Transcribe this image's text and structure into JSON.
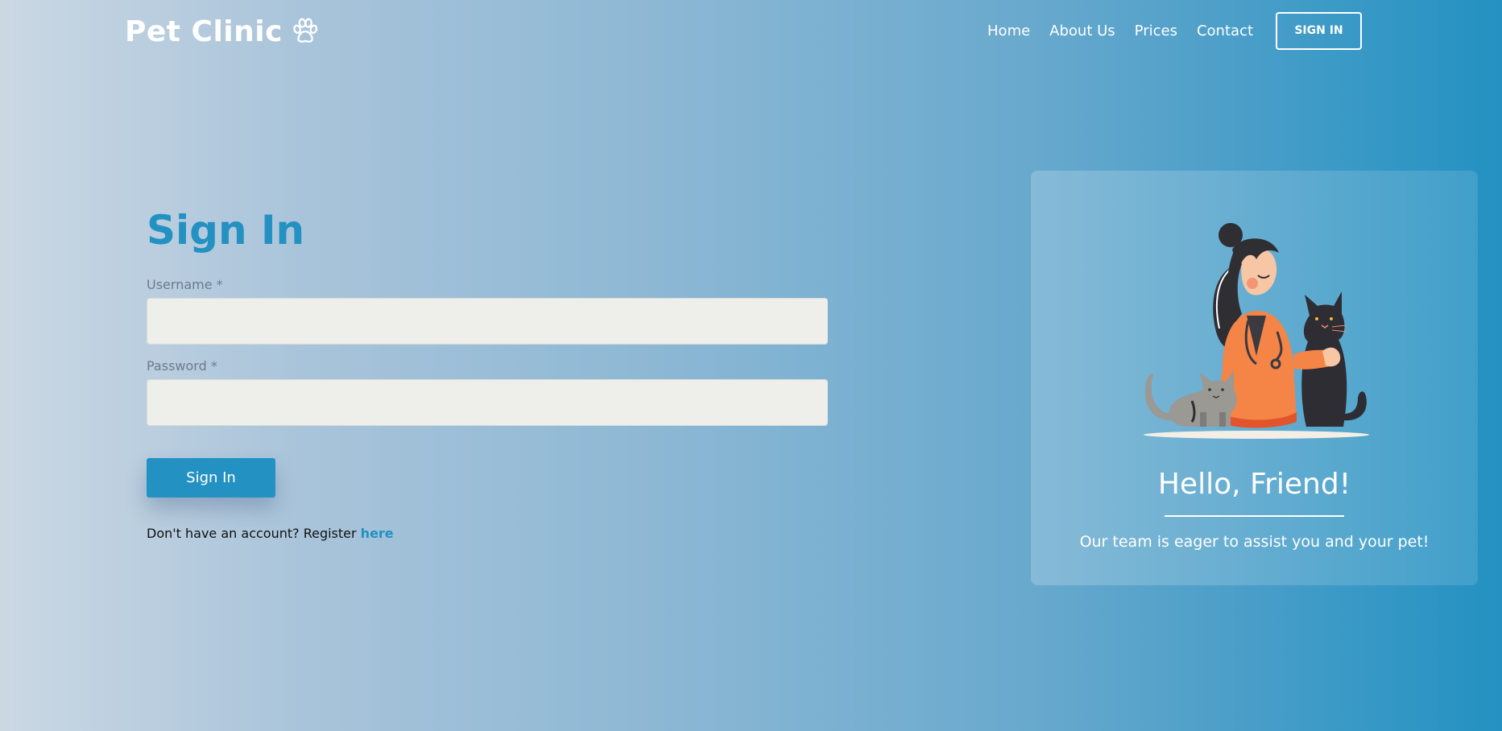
{
  "header": {
    "brand": "Pet Clinic",
    "brand_icon": "paw-icon",
    "nav": {
      "home": "Home",
      "about": "About Us",
      "prices": "Prices",
      "contact": "Contact",
      "signin": "SIGN IN"
    }
  },
  "form": {
    "title": "Sign In",
    "username_label": "Username *",
    "username_value": "",
    "password_label": "Password *",
    "password_value": "",
    "submit_label": "Sign In",
    "register_prompt": "Don't have an account? Register ",
    "register_link": "here"
  },
  "card": {
    "illustration": "vet-with-cats-illustration",
    "title": "Hello, Friend!",
    "subtitle": "Our team is eager to assist you and your pet!"
  },
  "colors": {
    "accent": "#2391c2",
    "input_background": "#eeeeea",
    "label": "#6b7b8c"
  }
}
